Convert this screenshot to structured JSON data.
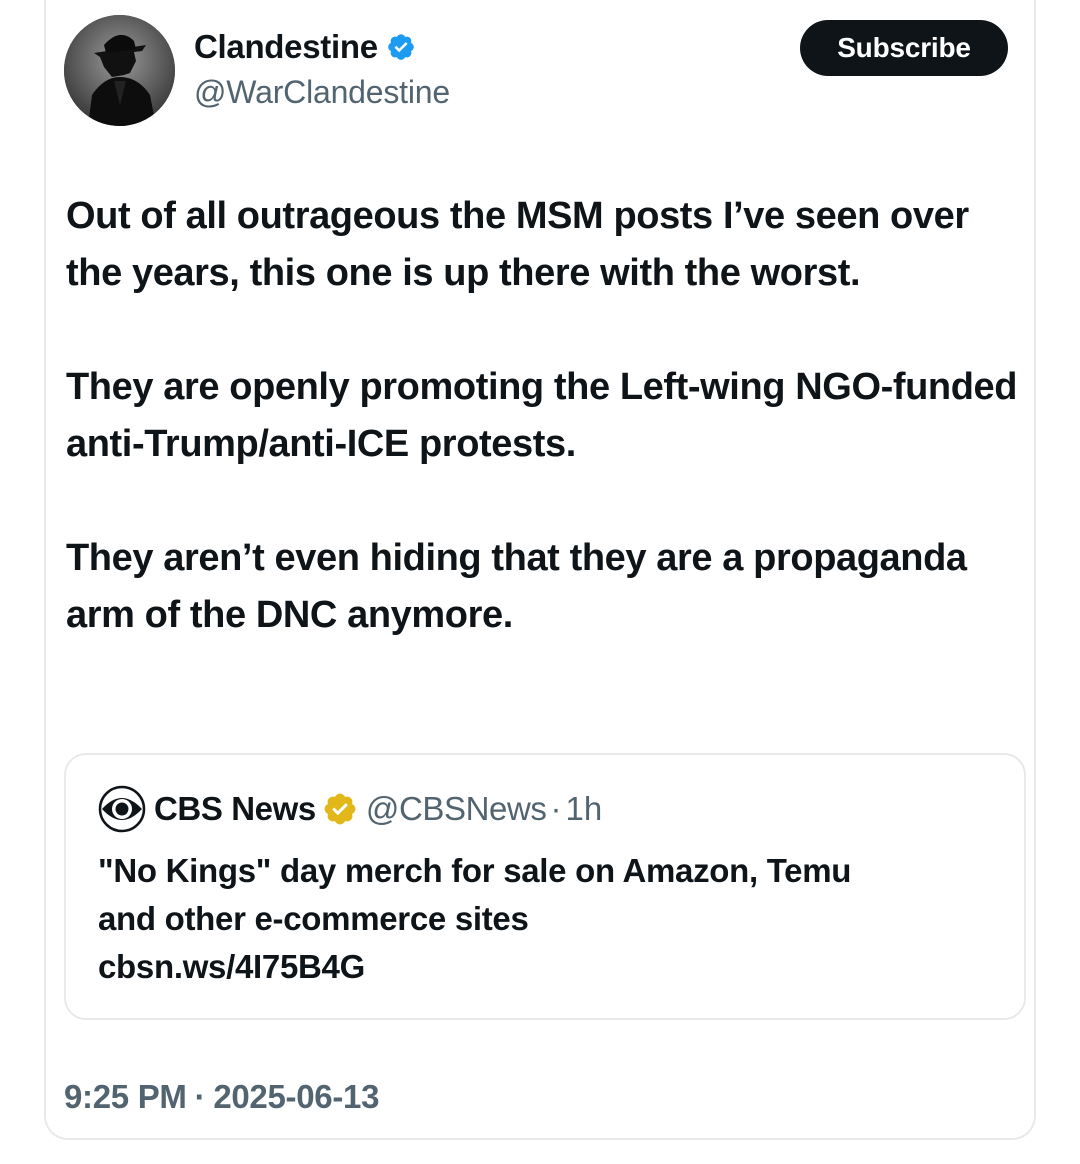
{
  "author": {
    "display_name": "Clandestine",
    "handle": "@WarClandestine",
    "verified_color": "#1d9bf0",
    "subscribe_label": "Subscribe"
  },
  "tweet": {
    "paragraphs": [
      "Out of all outrageous the MSM posts I’ve seen over the years, this one is up there with the worst.",
      "They are openly promoting the Left-wing NGO-funded anti-Trump/anti-ICE protests.",
      "They aren’t even hiding that they are a propaganda arm of the DNC anymore."
    ],
    "time": "9:25 PM",
    "date": "2025-06-13",
    "separator": "·"
  },
  "quote": {
    "display_name": "CBS News",
    "handle": "@CBSNews",
    "separator": "·",
    "age": "1h",
    "badge_color": "#e2b719",
    "lines": [
      "\"No Kings\" day merch for sale on Amazon, Temu",
      "and other e-commerce sites",
      "cbsn.ws/4I75B4G"
    ]
  },
  "icons": {
    "avatar": "spy-silhouette-avatar",
    "verified": "verified-badge-icon",
    "gold": "gold-verified-badge-icon",
    "cbs": "cbs-eye-logo"
  }
}
